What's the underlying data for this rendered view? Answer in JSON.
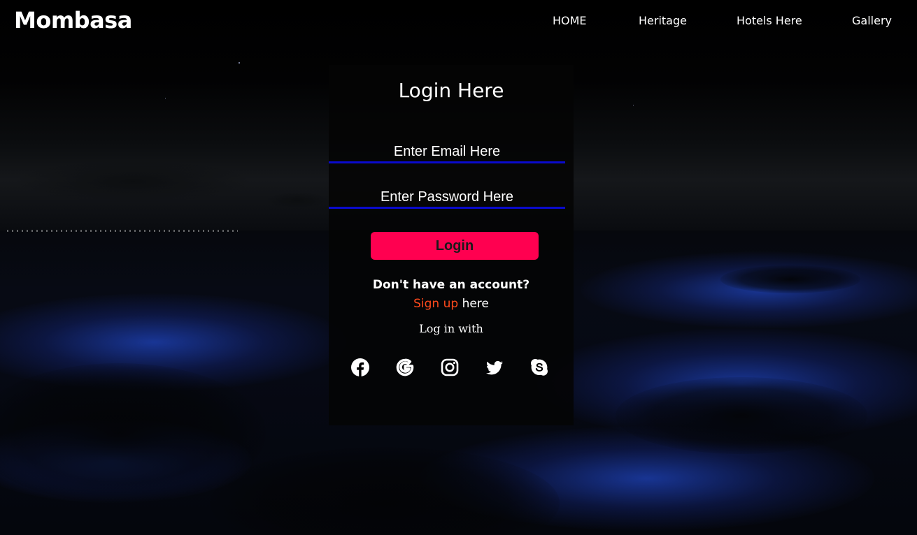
{
  "brand": {
    "name": "Mombasa"
  },
  "nav": {
    "items": [
      {
        "label": "HOME"
      },
      {
        "label": "Heritage"
      },
      {
        "label": "Hotels Here"
      },
      {
        "label": "Gallery"
      }
    ]
  },
  "login": {
    "title": "Login Here",
    "email_placeholder": "Enter Email Here",
    "password_placeholder": "Enter Password Here",
    "submit_label": "Login",
    "no_account_text": "Don't have an account?",
    "signup_link": "Sign up",
    "signup_suffix": " here",
    "login_with": "Log in with",
    "social_icons": [
      "facebook-icon",
      "google-icon",
      "instagram-icon",
      "twitter-icon",
      "skype-icon"
    ]
  },
  "colors": {
    "accent_button": "#ff0050",
    "signup_link": "#ff4a1c",
    "input_underline": "#0a0acc",
    "panel_bg": "#040405"
  }
}
